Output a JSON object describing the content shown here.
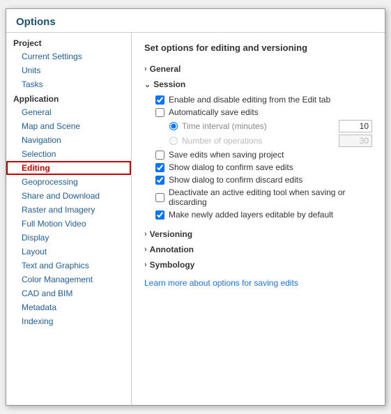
{
  "window": {
    "title": "Options"
  },
  "sidebar": {
    "groups": [
      {
        "label": "Project",
        "items": [
          {
            "label": "Current Settings",
            "id": "current-settings"
          },
          {
            "label": "Units",
            "id": "units"
          },
          {
            "label": "Tasks",
            "id": "tasks"
          }
        ]
      },
      {
        "label": "Application",
        "items": [
          {
            "label": "General",
            "id": "general"
          },
          {
            "label": "Map and Scene",
            "id": "map-and-scene"
          },
          {
            "label": "Navigation",
            "id": "navigation"
          },
          {
            "label": "Selection",
            "id": "selection"
          },
          {
            "label": "Editing",
            "id": "editing",
            "selected": true
          },
          {
            "label": "Geoprocessing",
            "id": "geoprocessing"
          },
          {
            "label": "Share and Download",
            "id": "share-and-download"
          },
          {
            "label": "Raster and Imagery",
            "id": "raster-and-imagery"
          },
          {
            "label": "Full Motion Video",
            "id": "full-motion-video"
          },
          {
            "label": "Display",
            "id": "display"
          },
          {
            "label": "Layout",
            "id": "layout"
          },
          {
            "label": "Text and Graphics",
            "id": "text-and-graphics"
          },
          {
            "label": "Color Management",
            "id": "color-management"
          },
          {
            "label": "CAD and BIM",
            "id": "cad-and-bim"
          },
          {
            "label": "Metadata",
            "id": "metadata"
          },
          {
            "label": "Indexing",
            "id": "indexing"
          }
        ]
      }
    ]
  },
  "main": {
    "title": "Set options for editing and versioning",
    "sections": [
      {
        "label": "General",
        "id": "general-section",
        "expanded": false,
        "chevron": "›"
      },
      {
        "label": "Session",
        "id": "session-section",
        "expanded": true,
        "chevron": "⌄"
      },
      {
        "label": "Versioning",
        "id": "versioning-section",
        "expanded": false,
        "chevron": "›"
      },
      {
        "label": "Annotation",
        "id": "annotation-section",
        "expanded": false,
        "chevron": "›"
      },
      {
        "label": "Symbology",
        "id": "symbology-section",
        "expanded": false,
        "chevron": "›"
      }
    ],
    "session": {
      "checkboxes": [
        {
          "label": "Enable and disable editing from the Edit tab",
          "checked": true,
          "id": "cb-enable"
        },
        {
          "label": "Automatically save edits",
          "checked": false,
          "id": "cb-autosave"
        }
      ],
      "radios": [
        {
          "label": "Time interval (minutes)",
          "value": "10",
          "disabled": false,
          "id": "rb-time"
        },
        {
          "label": "Number of operations",
          "value": "30",
          "disabled": true,
          "id": "rb-ops"
        }
      ],
      "checkboxes2": [
        {
          "label": "Save edits when saving project",
          "checked": false,
          "id": "cb-save-proj"
        },
        {
          "label": "Show dialog to confirm save edits",
          "checked": true,
          "id": "cb-confirm-save"
        },
        {
          "label": "Show dialog to confirm discard edits",
          "checked": true,
          "id": "cb-confirm-discard"
        },
        {
          "label": "Deactivate an active editing tool when saving or discarding",
          "checked": false,
          "id": "cb-deactivate"
        },
        {
          "label": "Make newly added layers editable by default",
          "checked": true,
          "id": "cb-editable"
        }
      ]
    },
    "learn_link": "Learn more about options for saving edits"
  }
}
